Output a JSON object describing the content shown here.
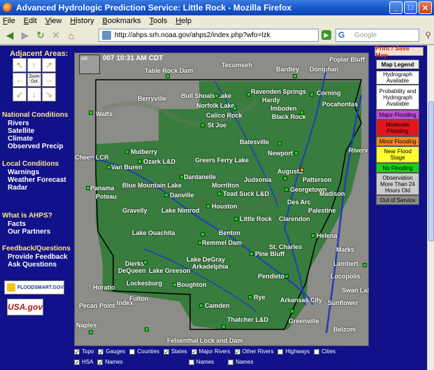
{
  "window": {
    "title": "Advanced Hydrologic Prediction Service: Little Rock - Mozilla Firefox"
  },
  "menu": [
    "File",
    "Edit",
    "View",
    "History",
    "Bookmarks",
    "Tools",
    "Help"
  ],
  "toolbar": {
    "url": "http://ahps.srh.noaa.gov/ahps2/index.php?wfo=lzk",
    "search_placeholder": "Google"
  },
  "sidebar": {
    "adjacent_title": "Adjacent Areas:",
    "zoom_label": "Zoom Out",
    "sections": [
      {
        "title": "National Conditions",
        "links": [
          "Rivers",
          "Satellite",
          "Climate",
          "Observed Precip"
        ]
      },
      {
        "title": "Local Conditions",
        "links": [
          "Warnings",
          "Weather Forecast",
          "Radar"
        ]
      },
      {
        "title": "What is AHPS?",
        "links": [
          "Facts",
          "Our Partners"
        ]
      },
      {
        "title": "Feedback/Questions",
        "links": [
          "Provide Feedback",
          "Ask Questions"
        ]
      }
    ],
    "logo1": "FLOODSMART.GOV",
    "logo2": "USA.gov"
  },
  "map": {
    "timestamp": "007 10:31 AM CDT",
    "inset": "AR",
    "places": [
      "Table Rock Dam",
      "Tecumseh",
      "Bardley",
      "Doniphan",
      "Poplar Bluff",
      "Bull Shoals Lake",
      "Berryville",
      "Ravenden Springs",
      "Corning",
      "Norfolk Lake",
      "Hardy",
      "Imboden",
      "Pocahontas",
      "Calico Rock",
      "Black Rock",
      "Watts",
      "St Joe",
      "Batesville",
      "Mulberry",
      "Ozark L&D",
      "Greers Ferry Lake",
      "Newport",
      "Van Buren",
      "Augusta",
      "Patterson",
      "Dardanelle",
      "Judsonia",
      "Blue Mountain Lake",
      "Morrilton",
      "Georgetown",
      "Panama",
      "Poteau",
      "Danville",
      "Toad Suck L&D",
      "Madison",
      "Des Arc",
      "Palestine",
      "Gravelly",
      "Lake Nimrod",
      "Houston",
      "Little Rock",
      "Clarendon",
      "Lake Ouachita",
      "Benton",
      "Helena",
      "Remmel Dam",
      "St. Charles",
      "Pine Bluff",
      "Marks",
      "Lake DeGray",
      "Arkadelphia",
      "DeQueen",
      "Dierks",
      "Lake Greeson",
      "Pendleton",
      "Lambert",
      "Lockesburg",
      "Boughton",
      "Horatio",
      "Locopolis",
      "Fulton",
      "Index",
      "Camden",
      "Rye",
      "Arkansas City",
      "Sunflower",
      "Swan Lake",
      "Pecan Point",
      "Naples",
      "Thatcher L&D",
      "Greenville",
      "Belzoni",
      "Felsenthal Lock and Dam",
      "Riverva",
      "Cheen LCR"
    ]
  },
  "checkboxes": {
    "row1": [
      {
        "label": "Topo",
        "checked": true
      },
      {
        "label": "Gauges",
        "checked": true
      },
      {
        "label": "Counties",
        "checked": false
      },
      {
        "label": "States",
        "checked": true
      },
      {
        "label": "Major Rivers",
        "checked": true
      },
      {
        "label": "Other Rivers",
        "checked": true
      },
      {
        "label": "Highways",
        "checked": false
      },
      {
        "label": "Cities",
        "checked": false
      }
    ],
    "row2": [
      {
        "label": "HSA",
        "checked": true
      },
      {
        "label": "Names",
        "checked": true
      },
      {
        "label": "Names",
        "checked": false
      },
      {
        "label": "Names",
        "checked": false
      }
    ]
  },
  "legend": {
    "print_label": "Print / Save Map",
    "title": "Map Legend",
    "items": [
      {
        "label": "Hydrograph Available",
        "color": "#ffffff"
      },
      {
        "label": "Probability and Hydrograph Available",
        "color": "#ffffff"
      },
      {
        "label": "Major Flooding",
        "color": "#c34ddb"
      },
      {
        "label": "Moderate Flooding",
        "color": "#e3161c"
      },
      {
        "label": "Minor Flooding",
        "color": "#f58a1f"
      },
      {
        "label": "Near Flood Stage",
        "color": "#ffff2e"
      },
      {
        "label": "No Flooding",
        "color": "#1ece1e"
      },
      {
        "label": "Observation More Than 24 Hours Old",
        "color": "#cccccc"
      },
      {
        "label": "Out of Service",
        "color": "#8c8c8c"
      }
    ]
  }
}
